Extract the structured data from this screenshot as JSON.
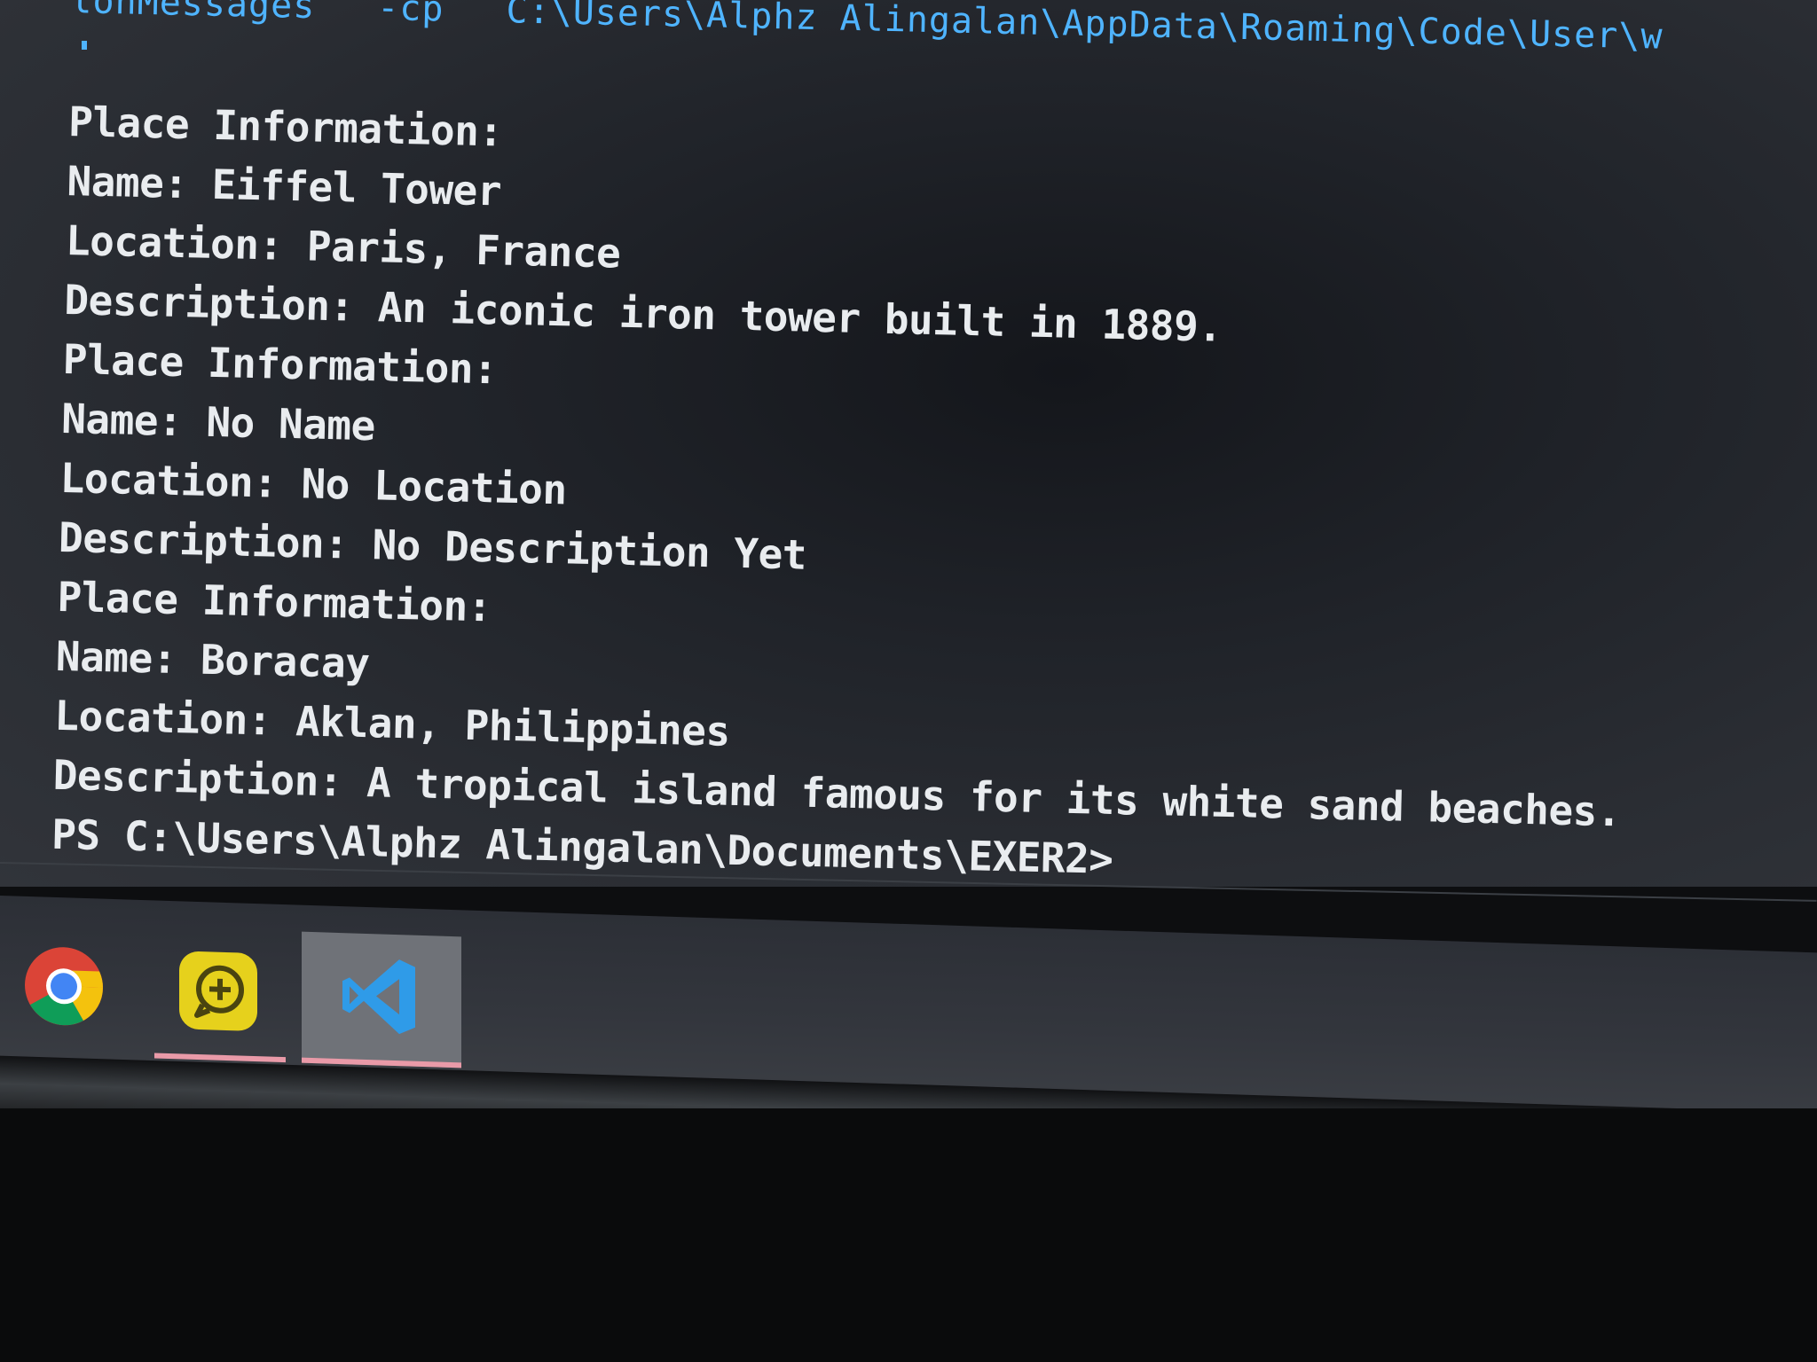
{
  "terminal": {
    "command_line": {
      "part1": "lonMessages",
      "part2": "-cp",
      "part3": "C:\\Users\\Alphz Alingalan\\AppData\\Roaming\\Code\\User\\w"
    },
    "output_lines": [
      "Place Information:",
      "Name: Eiffel Tower",
      "Location: Paris, France",
      "Description: An iconic iron tower built in 1889.",
      "Place Information:",
      "Name: No Name",
      "Location: No Location",
      "Description: No Description Yet",
      "Place Information:",
      "Name: Boracay",
      "Location: Aklan, Philippines",
      "Description: A tropical island famous for its white sand beaches.",
      "PS C:\\Users\\Alphz Alingalan\\Documents\\EXER2>"
    ]
  },
  "taskbar": {
    "items": [
      {
        "icon": "chrome-icon",
        "active": false,
        "running": false
      },
      {
        "icon": "feedback-hub-icon",
        "active": false,
        "running": true
      },
      {
        "icon": "vscode-icon",
        "active": true,
        "running": true
      }
    ]
  },
  "colors": {
    "terminal_text": "#e9ecef",
    "command_text": "#4fb4ff",
    "taskbar_indicator": "#e99aa8",
    "vscode_blue": "#2f9be8"
  }
}
